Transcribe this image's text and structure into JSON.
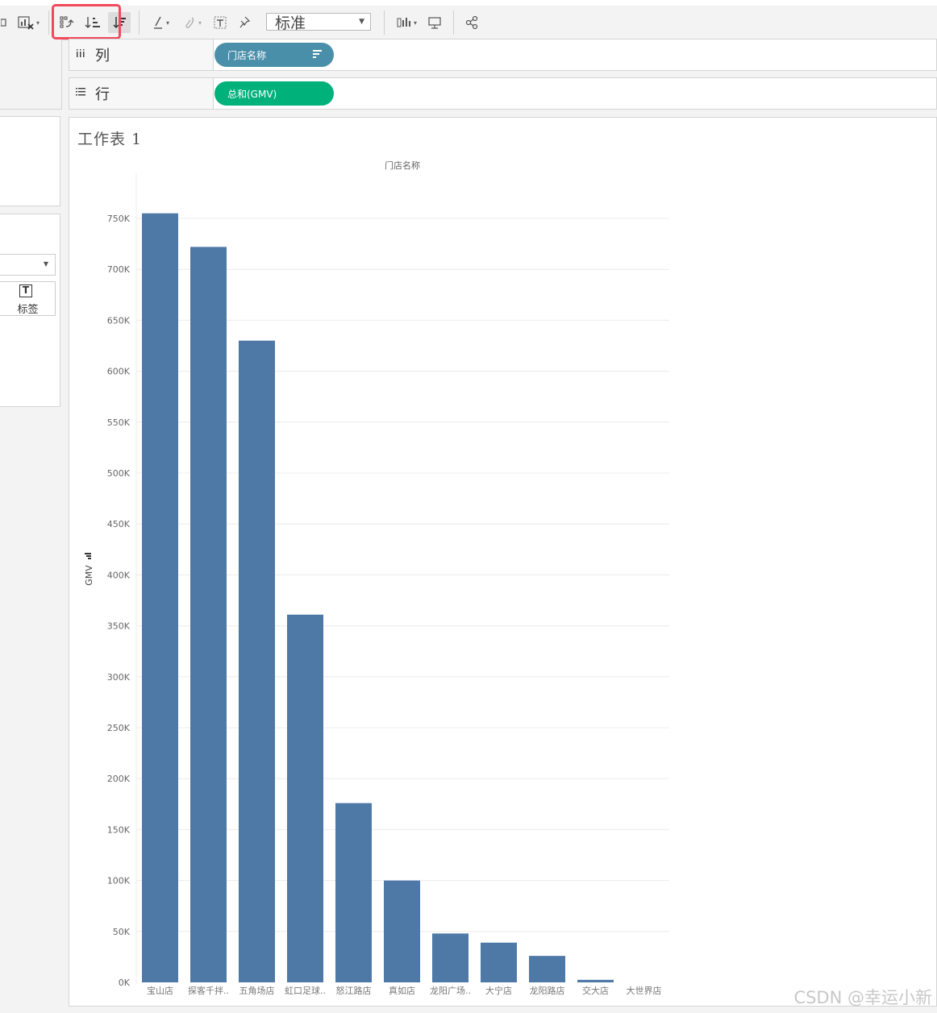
{
  "toolbar": {
    "fit_value": "标准",
    "highlighted_group": "sort-controls",
    "highlight_color": "#f2495c"
  },
  "shelves": {
    "columns_label": "列",
    "columns_icon": "columns-icon",
    "columns_pill": "门店名称",
    "rows_label": "行",
    "rows_icon": "rows-icon",
    "rows_pill": "总和(GMV)",
    "dimension_color": "#4a8fa9",
    "measure_color": "#00b17a"
  },
  "marks": {
    "label_button": "标签"
  },
  "worksheet": {
    "title": "工作表 1"
  },
  "chart_data": {
    "type": "bar",
    "title": "",
    "xlabel": "门店名称",
    "ylabel": "GMV",
    "ylim": [
      0,
      760000
    ],
    "y_ticks": [
      "0K",
      "50K",
      "100K",
      "150K",
      "200K",
      "250K",
      "300K",
      "350K",
      "400K",
      "450K",
      "500K",
      "550K",
      "600K",
      "650K",
      "700K",
      "750K"
    ],
    "y_tick_values": [
      0,
      50000,
      100000,
      150000,
      200000,
      250000,
      300000,
      350000,
      400000,
      450000,
      500000,
      550000,
      600000,
      650000,
      700000,
      750000
    ],
    "categories": [
      "宝山店",
      "探客千拌..",
      "五角场店",
      "虹口足球..",
      "怒江路店",
      "真如店",
      "龙阳广场..",
      "大宁店",
      "龙阳路店",
      "交大店",
      "大世界店"
    ],
    "values": [
      755000,
      722000,
      630000,
      361000,
      176000,
      100000,
      48000,
      39000,
      26000,
      2500,
      0
    ],
    "bar_color": "#4e79a7",
    "grid": true,
    "sort": "descending"
  },
  "watermark": "CSDN @幸运小新"
}
